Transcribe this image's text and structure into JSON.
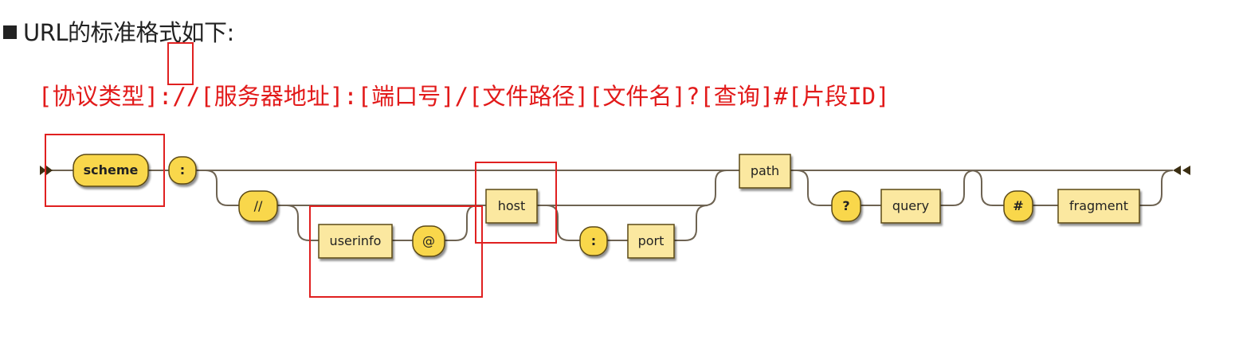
{
  "heading": "URL的标准格式如下:",
  "format_line": "[协议类型]://[服务器地址]:[端口号]/[文件路径][文件名]?[查询]#[片段ID]",
  "colors": {
    "terminal_fill": "#f9d74b",
    "nonterminal_fill": "#fbe8a0",
    "node_stroke": "#5b4a14",
    "track": "#6e6352",
    "highlight": "#e02020",
    "format_text": "#e21a1a"
  },
  "diagram": {
    "nodes": [
      {
        "id": "scheme",
        "label": "scheme",
        "kind": "terminal",
        "bold": true
      },
      {
        "id": "colon",
        "label": ":",
        "kind": "terminal",
        "bold": true
      },
      {
        "id": "slashes",
        "label": "//",
        "kind": "terminal",
        "bold": false
      },
      {
        "id": "userinfo",
        "label": "userinfo",
        "kind": "nonterminal",
        "bold": false
      },
      {
        "id": "at",
        "label": "@",
        "kind": "terminal",
        "bold": false
      },
      {
        "id": "host",
        "label": "host",
        "kind": "nonterminal",
        "bold": false
      },
      {
        "id": "port-colon",
        "label": ":",
        "kind": "terminal",
        "bold": true
      },
      {
        "id": "port",
        "label": "port",
        "kind": "nonterminal",
        "bold": false
      },
      {
        "id": "path",
        "label": "path",
        "kind": "nonterminal",
        "bold": false
      },
      {
        "id": "question",
        "label": "?",
        "kind": "terminal",
        "bold": true
      },
      {
        "id": "query",
        "label": "query",
        "kind": "nonterminal",
        "bold": false
      },
      {
        "id": "hash",
        "label": "#",
        "kind": "terminal",
        "bold": true
      },
      {
        "id": "fragment",
        "label": "fragment",
        "kind": "nonterminal",
        "bold": false
      }
    ],
    "highlights": [
      "scheme-box",
      "colon-box",
      "authority-user-box",
      "host-box"
    ]
  }
}
